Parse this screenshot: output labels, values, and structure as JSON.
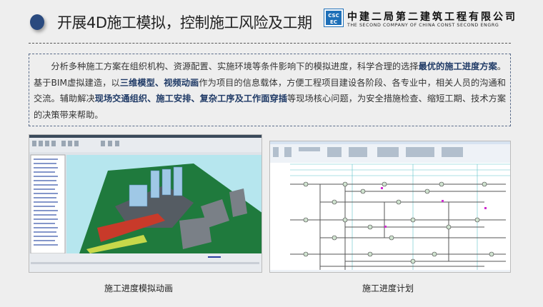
{
  "header": {
    "title": "开展4D施工模拟，控制施工风险及工期",
    "logo_text": "CSCEC",
    "company_cn": "中建二局第二建筑工程有限公司",
    "company_en": "THE SECOND COMPANY OF CHINA CONST SECOND ENGRG"
  },
  "intro": {
    "p1": "分析多种施工方案在组织机构、资源配置、实施环境等条件影响下的模拟进度，科学合理的选择",
    "b1": "最优的施工进度方案",
    "p2": "。基于BIM虚拟建造，以",
    "b2": "三维模型、视频动画",
    "p3": "作为项目的信息载体，方便工程项目建设各阶段、各专业中，相关人员的沟通和交流。辅助解决",
    "b3": "现场交通组织、施工安排、复杂工序及工作面穿插",
    "p4": "等现场核心问题，为安全措施检查、缩短工期、技术方案的决策带来帮助。"
  },
  "figures": [
    {
      "caption": "施工进度模拟动画"
    },
    {
      "caption": "施工进度计划"
    }
  ],
  "colors": {
    "accent": "#2a4a7f",
    "emphasis": "#1f3a66"
  }
}
